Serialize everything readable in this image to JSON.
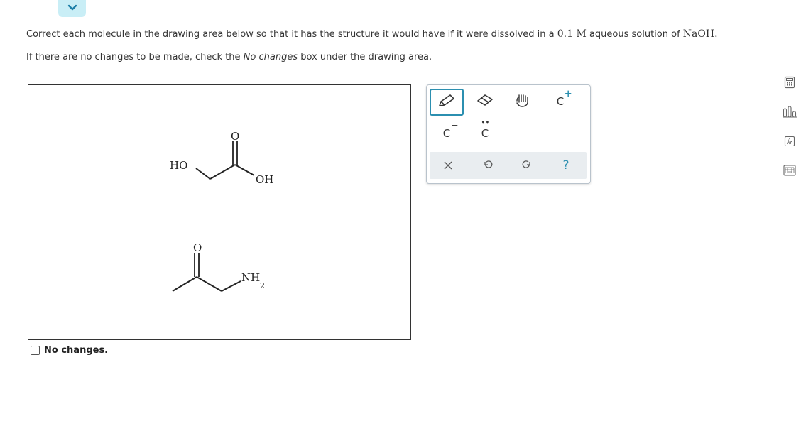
{
  "instructions": {
    "line1_pre": "Correct each molecule in the drawing area below so that it has the structure it would have if it were dissolved in a ",
    "line1_conc": "0.1 M",
    "line1_mid": " aqueous solution of ",
    "line1_base": "NaOH",
    "line1_end": ".",
    "line2_pre": "If there are no changes to be made, check the ",
    "line2_em": "No changes",
    "line2_post": " box under the drawing area."
  },
  "molecules": {
    "m1_oxygen": "O",
    "m1_ho": "HO",
    "m1_oh": "OH",
    "m2_oxygen": "O",
    "m2_nh": "NH",
    "m2_sub": "2"
  },
  "tools": {
    "carbanion_label": "C",
    "carbanion_charge": "−",
    "lonepair_label": "C",
    "lonepair_dots": "••",
    "carbocation_label": "C",
    "carbocation_charge": "+",
    "help_label": "?"
  },
  "no_changes": {
    "label": "No changes."
  },
  "colors": {
    "accent": "#2b8fb0",
    "collapse_bg": "#c9eef6",
    "toolbar_bg": "#e9edf0"
  }
}
